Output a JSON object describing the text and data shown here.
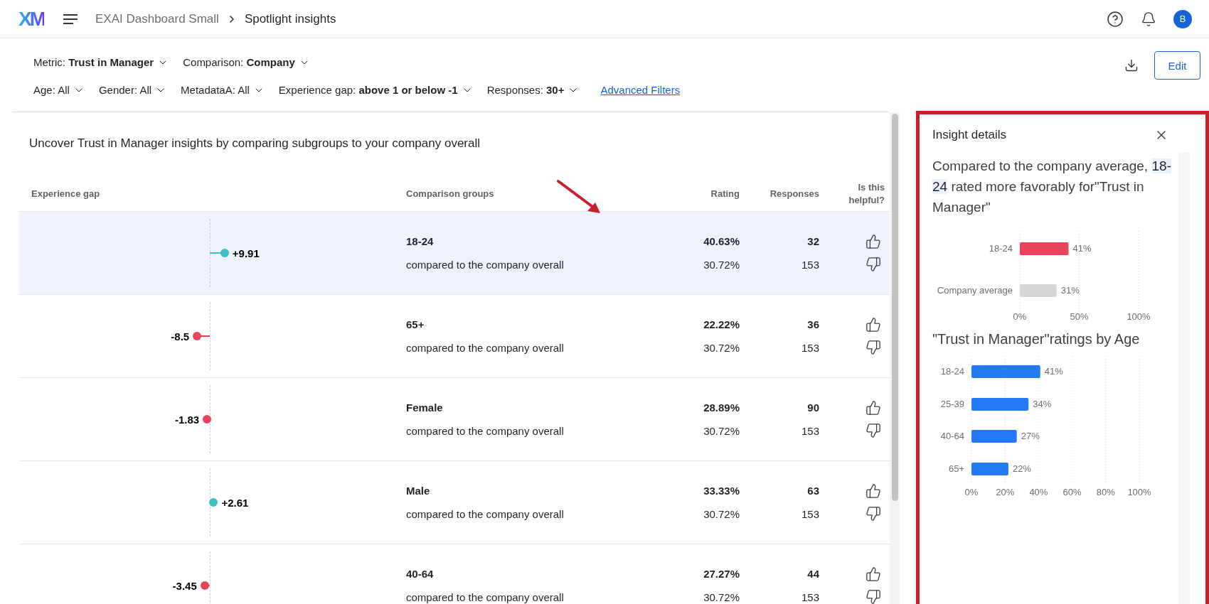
{
  "header": {
    "logo": "XM",
    "breadcrumb": [
      {
        "label": "EXAI Dashboard Small",
        "current": false
      },
      {
        "label": "Spotlight insights",
        "current": true
      }
    ],
    "avatar": "B"
  },
  "filters": {
    "primary": [
      "Metric: **Trust in Manager**",
      "Comparison: **Company**"
    ],
    "secondary": [
      "Age: All",
      "Gender: All",
      "MetadataA: All",
      "Experience gap: **above 1 or below -1**",
      "Responses: **30+**"
    ],
    "link": "Advanced Filters",
    "edit_button": "Edit"
  },
  "insights": {
    "intro": "Uncover Trust in Manager insights by comparing subgroups to your company overall",
    "columns": [
      "Experience gap",
      "Comparison groups",
      "Rating",
      "Responses",
      "Is this helpful?"
    ],
    "rows": [
      {
        "gap": "+9.91",
        "group": "18-24",
        "comparison": "compared to the company overall",
        "rating": "40.63%",
        "company_rating": "30.72%",
        "responses": "32",
        "company_responses": "153",
        "selected": true
      },
      {
        "gap": "-8.5",
        "group": "65+",
        "comparison": "compared to the company overall",
        "rating": "22.22%",
        "company_rating": "30.72%",
        "responses": "36",
        "company_responses": "153",
        "selected": false
      },
      {
        "gap": "-1.83",
        "group": "Female",
        "comparison": "compared to the company overall",
        "rating": "28.89%",
        "company_rating": "30.72%",
        "responses": "90",
        "company_responses": "153",
        "selected": false
      },
      {
        "gap": "+2.61",
        "group": "Male",
        "comparison": "compared to the company overall",
        "rating": "33.33%",
        "company_rating": "30.72%",
        "responses": "63",
        "company_responses": "153",
        "selected": false
      },
      {
        "gap": "-3.45",
        "group": "40-64",
        "comparison": "compared to the company overall",
        "rating": "27.27%",
        "company_rating": "30.72%",
        "responses": "44",
        "company_responses": "153",
        "selected": false
      }
    ]
  },
  "details": {
    "title": "Insight details",
    "summary": "Compared to the company average, **18-24** rated more favorably for\"Trust in Manager\"",
    "comparison_chart": {
      "chart_data": {
        "type": "bar",
        "orientation": "horizontal",
        "grid": true,
        "categories": [
          "18-24",
          "Company average"
        ],
        "series": [
          {
            "color": "#e8435a",
            "values": [
              41,
              null
            ]
          },
          {
            "color": "#d6d6d6",
            "values": [
              null,
              31
            ]
          }
        ],
        "xlim": [
          0,
          100
        ],
        "xticks": [
          {
            "value": 0,
            "label": "0%"
          },
          {
            "value": 50,
            "label": "50%"
          },
          {
            "value": 100,
            "label": "100%"
          }
        ],
        "value_labels": [
          "41%",
          "31%"
        ]
      }
    },
    "age_chart": {
      "title": "\"Trust in Manager\"ratings by Age",
      "chart_data": {
        "type": "bar",
        "orientation": "horizontal",
        "grid": true,
        "categories": [
          "18-24",
          "25-39",
          "40-64",
          "65+"
        ],
        "series": [
          {
            "color": "#2479f5",
            "values": [
              41,
              34,
              27,
              22
            ]
          }
        ],
        "xlim": [
          0,
          100
        ],
        "xticks": [
          {
            "value": 0,
            "label": "0%"
          },
          {
            "value": 20,
            "label": "20%"
          },
          {
            "value": 40,
            "label": "40%"
          },
          {
            "value": 60,
            "label": "60%"
          },
          {
            "value": 80,
            "label": "80%"
          },
          {
            "value": 100,
            "label": "100%"
          }
        ],
        "value_labels": [
          "41%",
          "34%",
          "27%",
          "22%"
        ]
      }
    }
  }
}
